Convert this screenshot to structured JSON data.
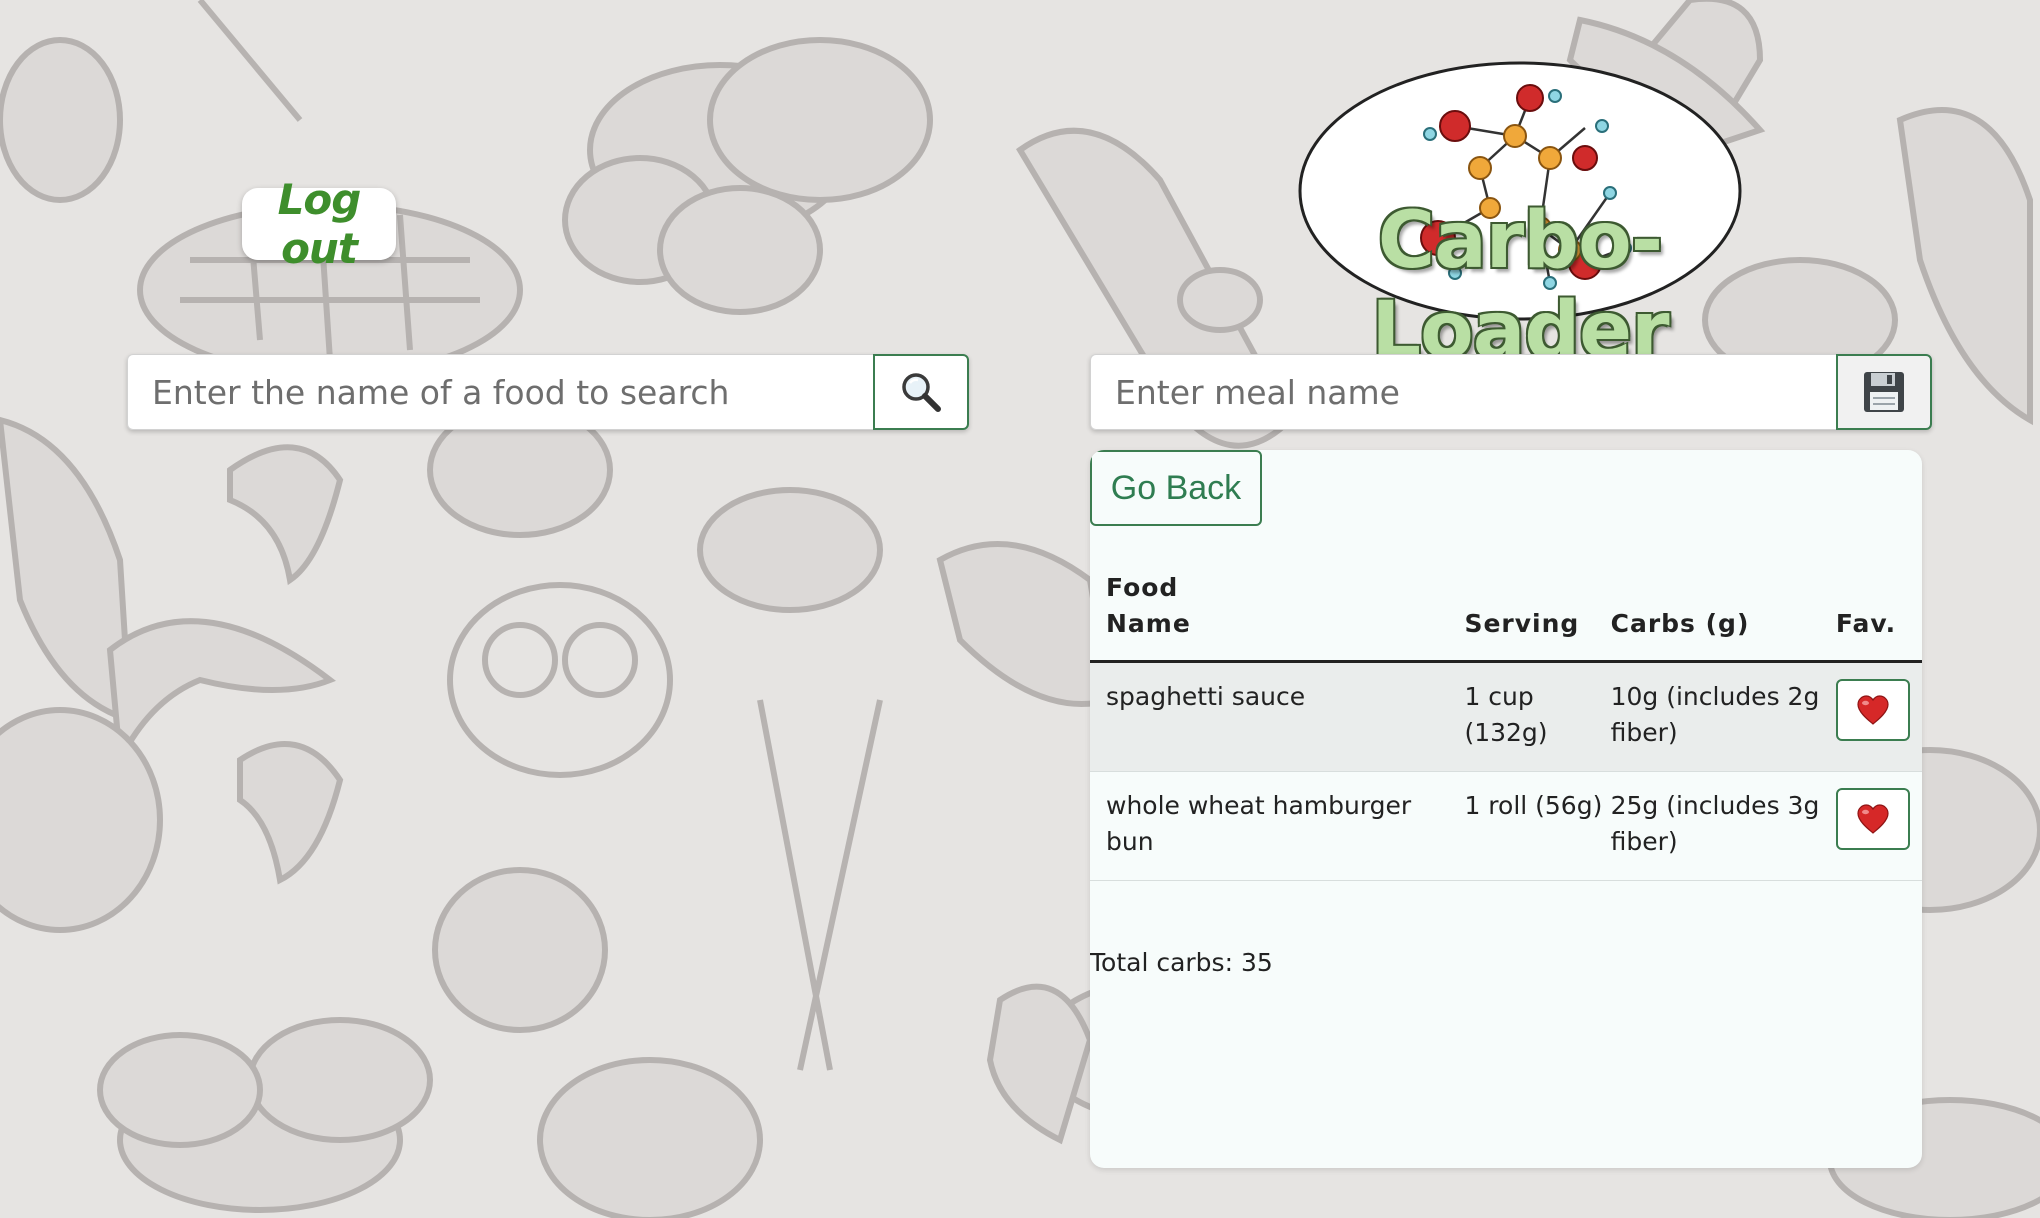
{
  "header": {
    "logout_label": "Log out",
    "logo_text": "Carbo-Loader"
  },
  "search": {
    "placeholder": "Enter the name of a food to search",
    "value": "",
    "button_icon": "magnifying-glass-icon"
  },
  "meal": {
    "placeholder": "Enter meal name",
    "value": "",
    "save_icon": "floppy-disk-icon"
  },
  "panel": {
    "go_back_label": "Go Back",
    "columns": [
      "Food Name",
      "Serving",
      "Carbs (g)",
      "Fav."
    ],
    "column_lines": {
      "food_line1": "Food",
      "food_line2": "Name",
      "serving": "Serving",
      "carbs": "Carbs (g)",
      "fav": "Fav."
    },
    "rows": [
      {
        "name": "spaghetti sauce",
        "serving": "1 cup (132g)",
        "carbs": "10g (includes 2g fiber)",
        "fav_icon": "heart-icon",
        "favorited": true
      },
      {
        "name": "whole wheat hamburger bun",
        "serving": "1 roll (56g)",
        "carbs": "25g (includes 3g fiber)",
        "fav_icon": "heart-icon",
        "favorited": true
      }
    ],
    "total_label": "Total carbs: 35"
  },
  "colors": {
    "accent": "#3b7d50",
    "logout_text": "#3e8e2c",
    "heart": "#d62828",
    "background": "#e6e4e2",
    "panel": "#f7fcfb"
  }
}
